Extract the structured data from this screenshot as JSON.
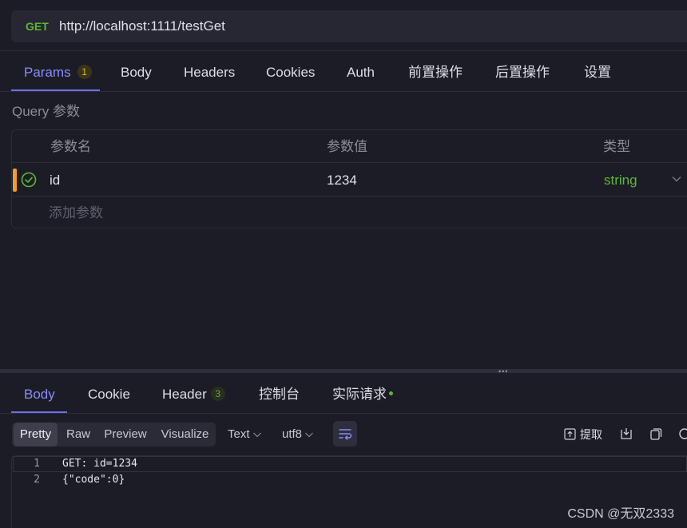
{
  "request": {
    "method": "GET",
    "url": "http://localhost:1111/testGet"
  },
  "tabs": [
    {
      "label": "Params",
      "badge": "1"
    },
    {
      "label": "Body"
    },
    {
      "label": "Headers"
    },
    {
      "label": "Cookies"
    },
    {
      "label": "Auth"
    },
    {
      "label": "前置操作"
    },
    {
      "label": "后置操作"
    },
    {
      "label": "设置"
    }
  ],
  "query": {
    "title": "Query 参数",
    "columns": [
      "参数名",
      "参数值",
      "类型"
    ],
    "rows": [
      {
        "name": "id",
        "value": "1234",
        "type": "string"
      }
    ],
    "add_placeholder": "添加参数"
  },
  "response": {
    "tabs": [
      {
        "label": "Body"
      },
      {
        "label": "Cookie"
      },
      {
        "label": "Header",
        "count": "3"
      },
      {
        "label": "控制台"
      },
      {
        "label": "实际请求"
      }
    ],
    "views": [
      "Pretty",
      "Raw",
      "Preview",
      "Visualize"
    ],
    "format": "Text",
    "encoding": "utf8",
    "extract_label": "提取",
    "lines": [
      {
        "num": "1",
        "text": "GET: id=1234"
      },
      {
        "num": "2",
        "text": "{\"code\":0}"
      }
    ]
  },
  "watermark": "CSDN @无双2333",
  "colors": {
    "accent": "#8c8cf8",
    "method_get": "#5bb832",
    "row_marker": "#f0a020"
  }
}
